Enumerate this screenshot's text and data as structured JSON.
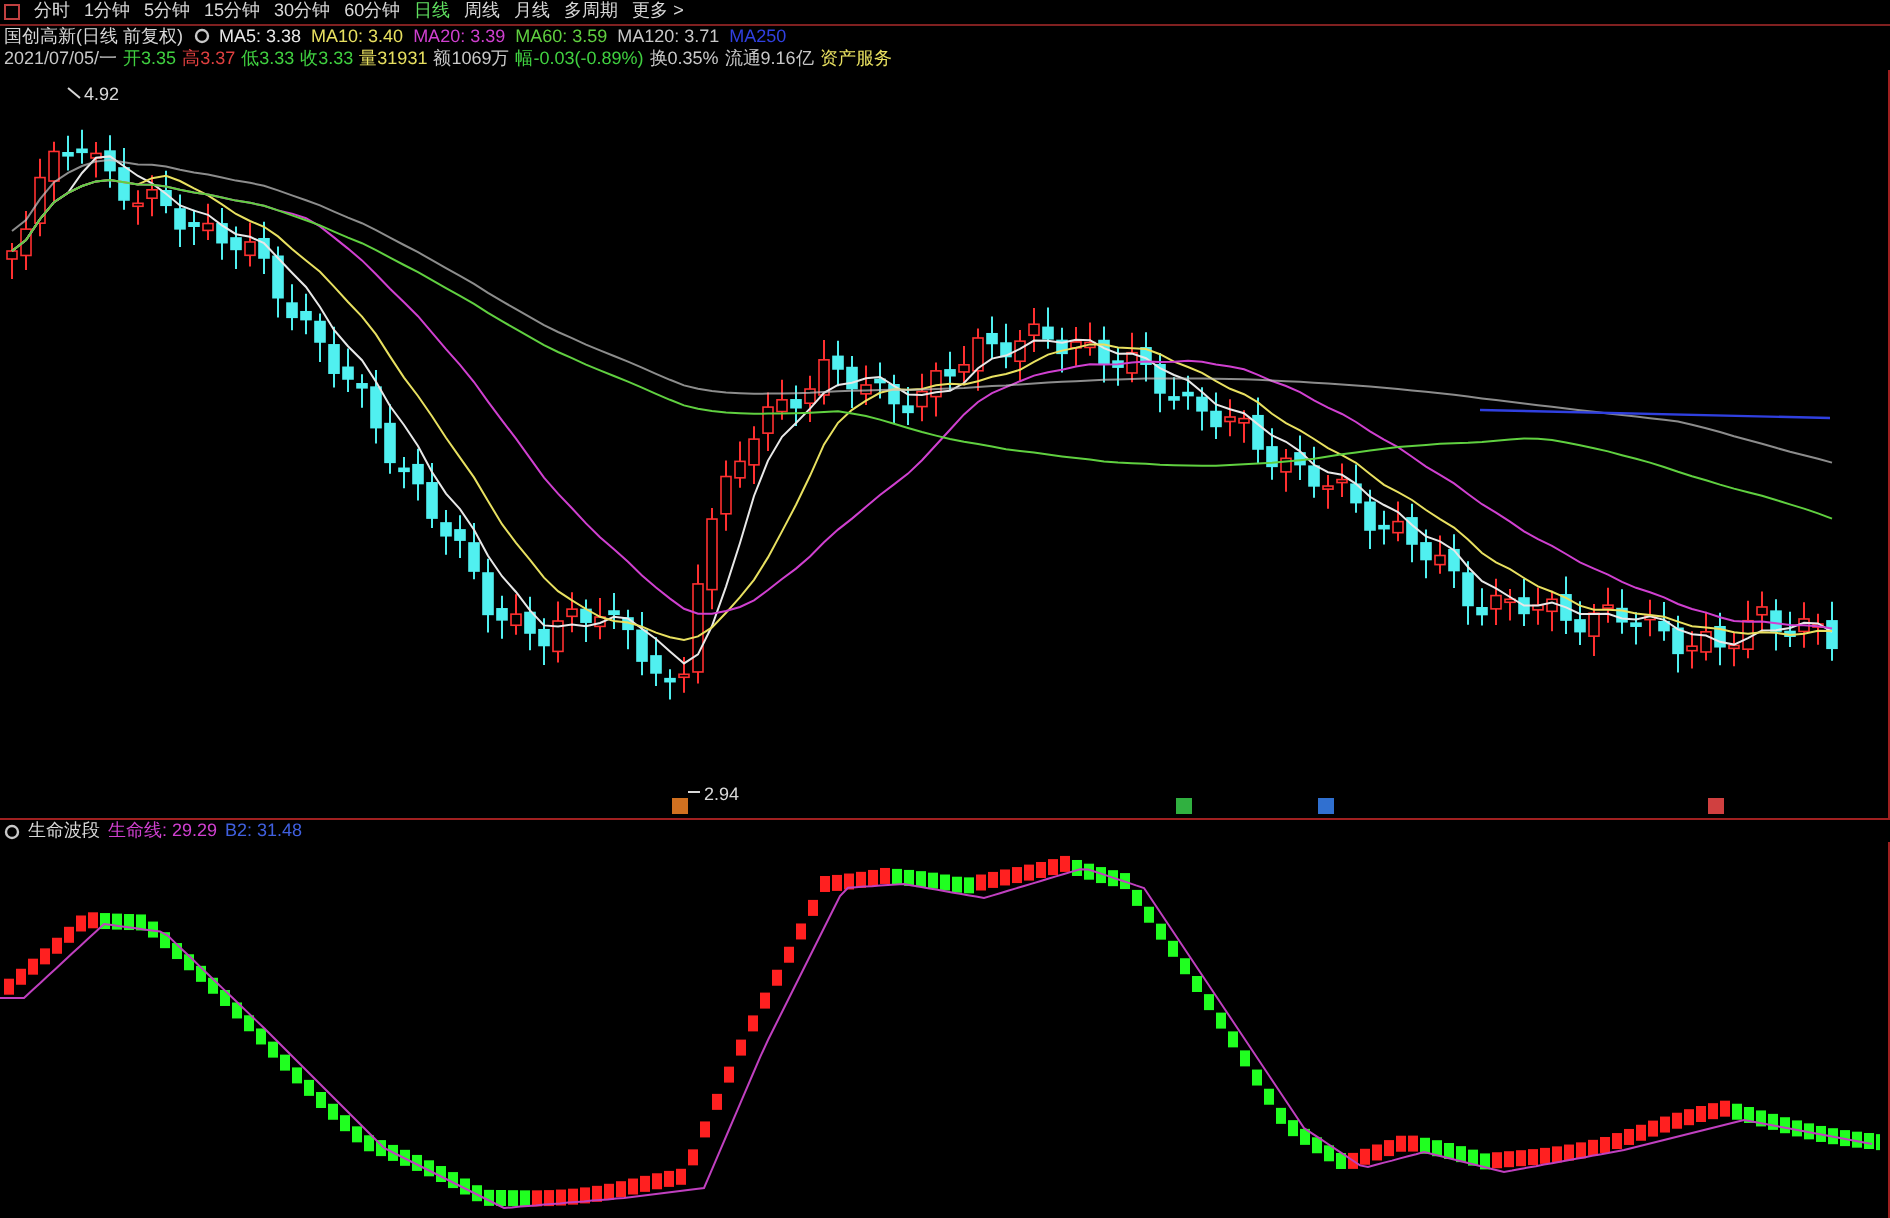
{
  "period_tabs": [
    {
      "label": "分时",
      "selected": false
    },
    {
      "label": "1分钟",
      "selected": false
    },
    {
      "label": "5分钟",
      "selected": false
    },
    {
      "label": "15分钟",
      "selected": false
    },
    {
      "label": "30分钟",
      "selected": false
    },
    {
      "label": "60分钟",
      "selected": false
    },
    {
      "label": "日线",
      "selected": true
    },
    {
      "label": "周线",
      "selected": false
    },
    {
      "label": "月线",
      "selected": false
    },
    {
      "label": "多周期",
      "selected": false
    },
    {
      "label": "更多 >",
      "selected": false
    }
  ],
  "stock_title": "国创高新(日线 前复权)",
  "moving_averages": [
    {
      "label": "MA5: 3.38",
      "color": "#e8e8e8"
    },
    {
      "label": "MA10: 3.40",
      "color": "#e8e060"
    },
    {
      "label": "MA20: 3.39",
      "color": "#d040d0"
    },
    {
      "label": "MA60: 3.59",
      "color": "#60d040"
    },
    {
      "label": "MA120: 3.71",
      "color": "#c8c8c8"
    },
    {
      "label": "MA250",
      "color": "#3040e0"
    }
  ],
  "quote_fields": [
    {
      "text": "2021/07/05/一",
      "color": "#c8c8c8"
    },
    {
      "text": "开3.35",
      "color": "#40d040"
    },
    {
      "text": "高3.37",
      "color": "#e04040"
    },
    {
      "text": "低3.33",
      "color": "#40d040"
    },
    {
      "text": "收3.33",
      "color": "#40d040"
    },
    {
      "text": "量31931",
      "color": "#e8e060"
    },
    {
      "text": "额1069万",
      "color": "#c8c8c8"
    },
    {
      "text": "幅-0.03(-0.89%)",
      "color": "#40d040"
    },
    {
      "text": "换0.35%",
      "color": "#c8c8c8"
    },
    {
      "text": "流通9.16亿",
      "color": "#c8c8c8"
    },
    {
      "text": "资产服务",
      "color": "#e8e060"
    }
  ],
  "price_high_label": "4.92",
  "price_low_label": "2.94",
  "event_markers": [
    {
      "color": "#d07020"
    },
    {
      "color": "#30b040"
    },
    {
      "color": "#3070d0"
    },
    {
      "color": "#d04040"
    }
  ],
  "indicator": {
    "name": "生命波段",
    "readings": [
      {
        "label": "生命线: 29.29",
        "color": "#d040d0"
      },
      {
        "label": "B2: 31.48",
        "color": "#4060e0"
      }
    ]
  }
}
